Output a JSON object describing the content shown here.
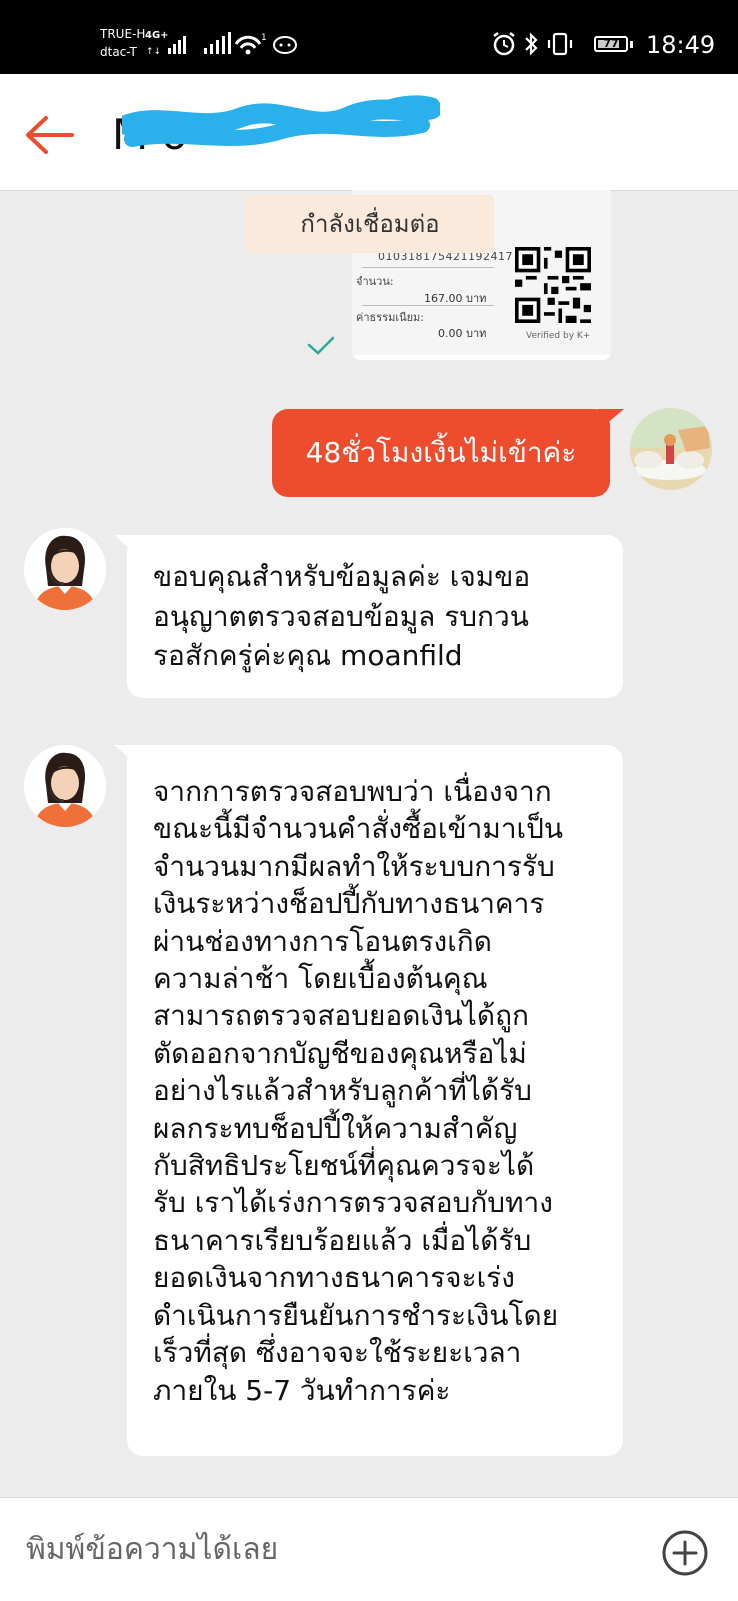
{
  "status_bar": {
    "carrier_primary": "TRUE-H",
    "carrier_secondary": "dtac-T",
    "network_type": "4G+",
    "battery_level": "77",
    "time": "18:49"
  },
  "header": {
    "contact_name": "M                 o"
  },
  "payment_slip": {
    "reference_number": "010318175421192417",
    "amount_label": "จำนวน:",
    "amount_value": "167.00 บาท",
    "fee_label": "ค่าธรรมเนียม:",
    "fee_value": "0.00 บาท",
    "verified_text": "Verified by K+",
    "connecting_label": "กำลังเชื่อมต่อ"
  },
  "messages": {
    "outgoing_1": "48ชั่วโมงเงิ้นไม่เข้าค่ะ",
    "incoming_1": {
      "lines": [
        "ขอบคุณสำหรับข้อมูลค่ะ เจมขอ",
        "อนุญาตตรวจสอบข้อมูล รบกวน",
        "รอสักครู่ค่ะคุณ moanfild"
      ]
    },
    "incoming_2": {
      "lines": [
        "จากการตรวจสอบพบว่า เนื่องจาก",
        "ขณะนี้มีจำนวนคำสั่งซื้อเข้ามาเป็น",
        "จำนวนมากมีผลทำให้ระบบการรับ",
        "เงินระหว่างช็อปปี้กับทางธนาคาร",
        "ผ่านช่องทางการโอนตรงเกิด",
        "ความล่าช้า โดยเบื้องต้นคุณ",
        "สามารถตรวจสอบยอดเงินได้ถูก",
        "ตัดออกจากบัญชีของคุณหรือไม่",
        "อย่างไรแล้วสำหรับลูกค้าที่ได้รับ",
        "ผลกระทบช็อปปี้ให้ความสำคัญ",
        "กับสิทธิประโยชน์ที่คุณควรจะได้",
        "รับ เราได้เร่งการตรวจสอบกับทาง",
        "ธนาคารเรียบร้อยแล้ว เมื่อได้รับ",
        "ยอดเงินจากทางธนาคารจะเร่ง",
        "ดำเนินการยืนยันการชำระเงินโดย",
        "เร็วที่สุด ซึ่งอาจจะใช้ระยะเวลา",
        "ภายใน 5-7 วันทำการค่ะ"
      ]
    }
  },
  "composer": {
    "placeholder": "พิมพ์ข้อความได้เลย"
  },
  "colors": {
    "brand": "#ee4d2d",
    "background": "#ececec",
    "redaction": "#2ab0ea"
  },
  "icons": [
    "back-arrow-icon",
    "signal-icon",
    "wifi-icon",
    "alarm-icon",
    "bluetooth-icon",
    "vibrate-icon",
    "battery-icon",
    "qr-code-icon",
    "checkmark-icon",
    "plus-circle-icon"
  ]
}
